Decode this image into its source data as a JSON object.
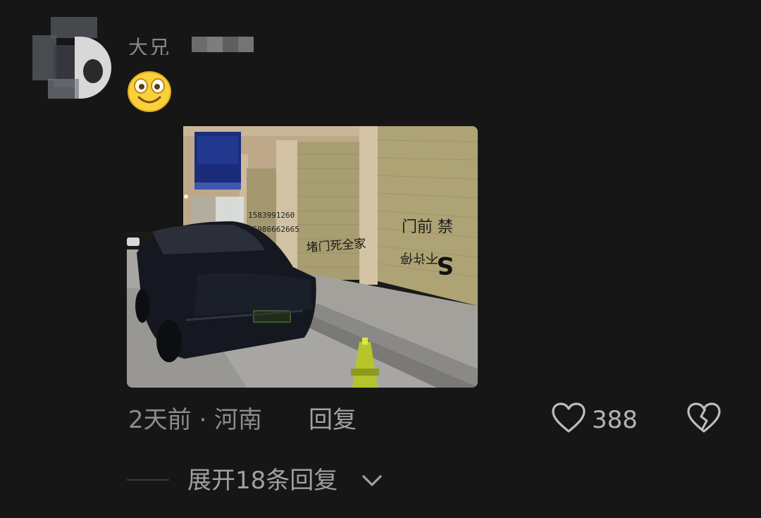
{
  "comment": {
    "username": "大兄",
    "emoji": "smiling-face-emoji",
    "time_location": "2天前 · 河南",
    "reply_label": "回复",
    "like_count": "388"
  },
  "photo": {
    "signs": [
      "门前禁",
      "不许停",
      "堵门死全家",
      "1583991260",
      "15986662665"
    ]
  },
  "replies": {
    "expand_label": "展开18条回复"
  },
  "colors": {
    "background": "#161616",
    "text_muted": "#8c8c8c",
    "text_light": "#b4b4b4"
  }
}
